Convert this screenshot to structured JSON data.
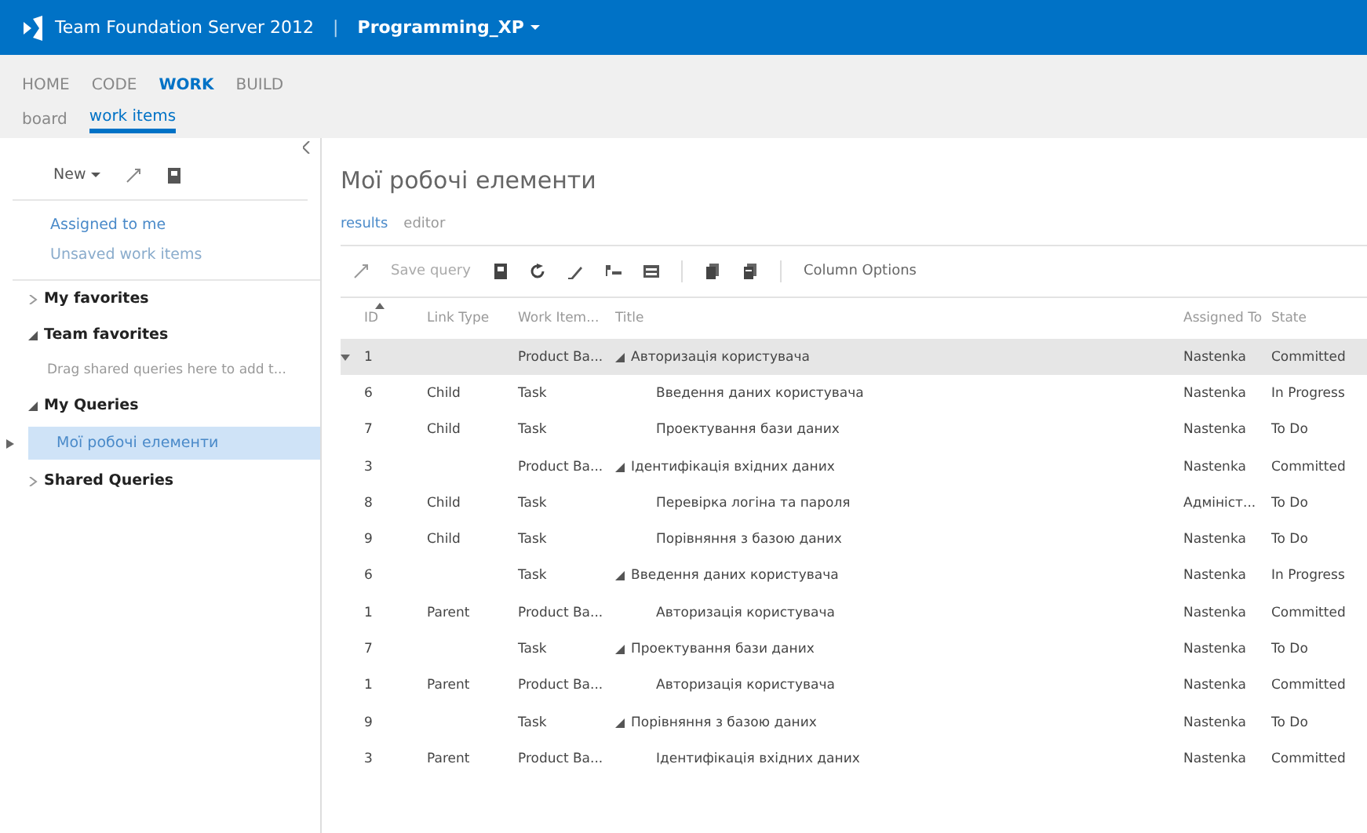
{
  "header": {
    "product": "Team Foundation Server 2012",
    "separator": "|",
    "project": "Programming_XP"
  },
  "nav": {
    "hubs": [
      {
        "label": "HOME",
        "selected": false
      },
      {
        "label": "CODE",
        "selected": false
      },
      {
        "label": "WORK",
        "selected": true
      },
      {
        "label": "BUILD",
        "selected": false
      }
    ],
    "pages": [
      {
        "label": "board",
        "selected": false
      },
      {
        "label": "work items",
        "selected": true
      }
    ]
  },
  "sidebar": {
    "new_button": "New",
    "links": [
      "Assigned to me",
      "Unsaved work items"
    ],
    "groups": [
      {
        "label": "My favorites",
        "expanded": false
      },
      {
        "label": "Team favorites",
        "expanded": true,
        "hint": "Drag shared queries here to add t..."
      },
      {
        "label": "My Queries",
        "expanded": true,
        "children": [
          {
            "label": "Мої робочі елементи",
            "selected": true
          }
        ]
      },
      {
        "label": "Shared Queries",
        "expanded": false
      }
    ]
  },
  "main": {
    "title": "Мої робочі елементи",
    "tabs": [
      {
        "label": "results",
        "selected": true
      },
      {
        "label": "editor",
        "selected": false
      }
    ],
    "toolbar": {
      "save": "Save query",
      "column_options": "Column Options"
    },
    "table": {
      "columns": [
        "ID",
        "Link Type",
        "Work Item...",
        "Title",
        "Assigned To",
        "State"
      ],
      "rows": [
        {
          "id": "1",
          "link_type": "",
          "work_item": "Product Ba...",
          "title": "Авторизація користувача",
          "assigned_to": "Nastenka",
          "state": "Committed",
          "selected": true,
          "expanded": true,
          "children": [
            {
              "id": "6",
              "link_type": "Child",
              "work_item": "Task",
              "title": "Введення даних користувача",
              "assigned_to": "Nastenka",
              "state": "In Progress",
              "selected": false
            },
            {
              "id": "7",
              "link_type": "Child",
              "work_item": "Task",
              "title": "Проектування бази даних",
              "assigned_to": "Nastenka",
              "state": "To Do",
              "selected": false
            }
          ]
        },
        {
          "id": "3",
          "link_type": "",
          "work_item": "Product Ba...",
          "title": "Ідентифікація вхідних даних",
          "assigned_to": "Nastenka",
          "state": "Committed",
          "selected": false,
          "expanded": true,
          "children": [
            {
              "id": "8",
              "link_type": "Child",
              "work_item": "Task",
              "title": "Перевірка логіна та пароля",
              "assigned_to": "Адмініст...",
              "state": "To Do",
              "selected": false
            },
            {
              "id": "9",
              "link_type": "Child",
              "work_item": "Task",
              "title": "Порівняння з базою даних",
              "assigned_to": "Nastenka",
              "state": "To Do",
              "selected": false
            }
          ]
        },
        {
          "id": "6",
          "link_type": "",
          "work_item": "Task",
          "title": "Введення даних користувача",
          "assigned_to": "Nastenka",
          "state": "In Progress",
          "selected": false,
          "expanded": true,
          "children": [
            {
              "id": "1",
              "link_type": "Parent",
              "work_item": "Product Ba...",
              "title": "Авторизація користувача",
              "assigned_to": "Nastenka",
              "state": "Committed",
              "selected": false
            }
          ]
        },
        {
          "id": "7",
          "link_type": "",
          "work_item": "Task",
          "title": "Проектування бази даних",
          "assigned_to": "Nastenka",
          "state": "To Do",
          "selected": false,
          "expanded": true,
          "children": [
            {
              "id": "1",
              "link_type": "Parent",
              "work_item": "Product Ba...",
              "title": "Авторизація користувача",
              "assigned_to": "Nastenka",
              "state": "Committed",
              "selected": false
            }
          ]
        },
        {
          "id": "9",
          "link_type": "",
          "work_item": "Task",
          "title": "Порівняння з базою даних",
          "assigned_to": "Nastenka",
          "state": "To Do",
          "selected": false,
          "expanded": true,
          "children": [
            {
              "id": "3",
              "link_type": "Parent",
              "work_item": "Product Ba...",
              "title": "Ідентифікація вхідних даних",
              "assigned_to": "Nastenka",
              "state": "Committed",
              "selected": false
            }
          ]
        }
      ]
    }
  }
}
